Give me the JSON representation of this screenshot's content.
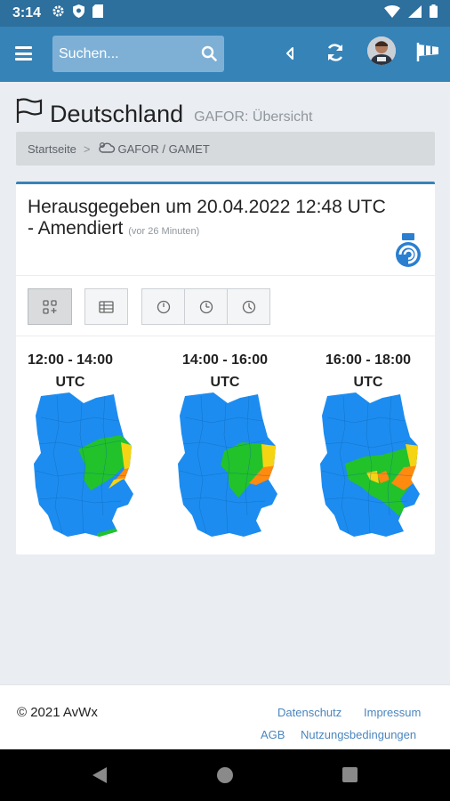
{
  "status_bar": {
    "time": "3:14"
  },
  "navbar": {
    "search_placeholder": "Suchen..."
  },
  "page": {
    "title": "Deutschland",
    "subtitle": "GAFOR: Übersicht"
  },
  "breadcrumb": {
    "home": "Startseite",
    "separator": ">",
    "current": "GAFOR / GAMET"
  },
  "card": {
    "title_line1": "Herausgegeben um 20.04.2022 12:48 UTC",
    "title_line2": "- Amendiert",
    "ago": "(vor 26 Minuten)"
  },
  "periods": [
    {
      "line1": "12:00 - 14:00",
      "line2": "UTC"
    },
    {
      "line1": "14:00 - 16:00",
      "line2": "UTC"
    },
    {
      "line1": "16:00 - 18:00",
      "line2": "UTC"
    }
  ],
  "colors": {
    "blue": "#1c8cf0",
    "green": "#22c22b",
    "yellow": "#f5d413",
    "orange": "#ff8a10",
    "header": "#3683b8"
  },
  "footer": {
    "copyright": "© 2021 AvWx",
    "links": [
      "Datenschutz",
      "Impressum",
      "AGB",
      "Nutzungsbedingungen"
    ]
  }
}
